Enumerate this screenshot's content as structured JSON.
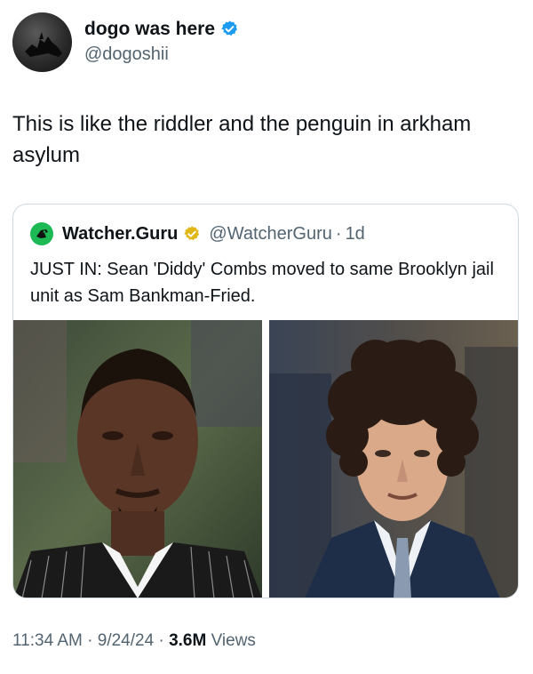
{
  "author": {
    "display_name": "dogo was here",
    "handle": "@dogoshii",
    "verified_icon": "verified-badge-icon",
    "verified_color": "#1d9bf0"
  },
  "tweet": {
    "text": "This is like the riddler and the penguin in arkham asylum"
  },
  "quoted_tweet": {
    "display_name": "Watcher.Guru",
    "handle": "@WatcherGuru",
    "separator": "·",
    "age": "1d",
    "verified_icon": "gold-verified-badge-icon",
    "verified_color": "#e2b719",
    "logo_icon": "watcher-guru-logo-icon",
    "logo_color": "#1db954",
    "text": "JUST IN: Sean 'Diddy' Combs moved to same Brooklyn jail unit as Sam Bankman-Fried.",
    "photos": [
      "photo-left",
      "photo-right"
    ]
  },
  "meta": {
    "time": "11:34 AM",
    "sep1": "·",
    "date": "9/24/24",
    "sep2": "·",
    "views_count": "3.6M",
    "views_label": "Views"
  }
}
